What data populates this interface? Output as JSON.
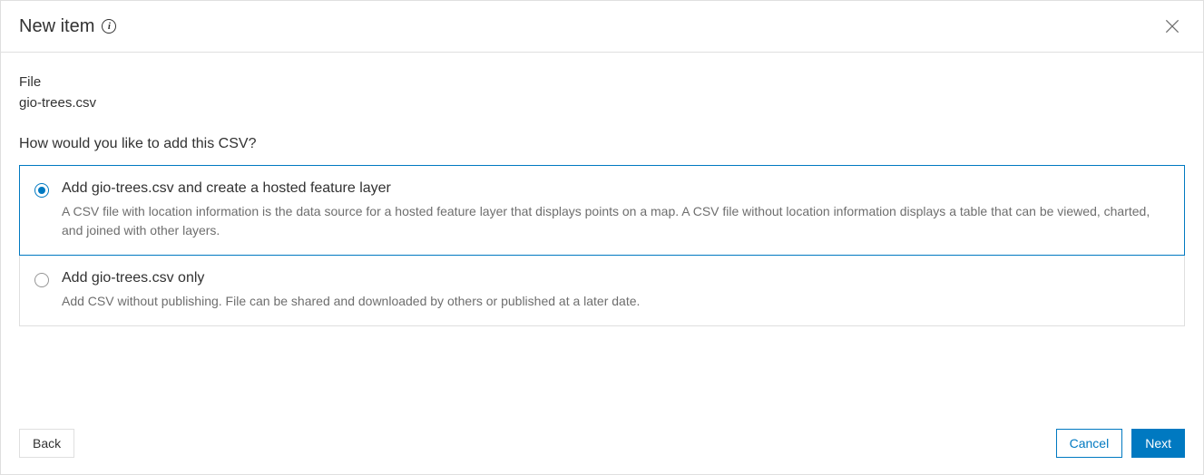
{
  "header": {
    "title": "New item"
  },
  "body": {
    "file_label": "File",
    "file_name": "gio-trees.csv",
    "question": "How would you like to add this CSV?",
    "options": [
      {
        "title": "Add gio-trees.csv and create a hosted feature layer",
        "desc": "A CSV file with location information is the data source for a hosted feature layer that displays points on a map. A CSV file without location information displays a table that can be viewed, charted, and joined with other layers.",
        "selected": true
      },
      {
        "title": "Add gio-trees.csv only",
        "desc": "Add CSV without publishing. File can be shared and downloaded by others or published at a later date.",
        "selected": false
      }
    ]
  },
  "footer": {
    "back": "Back",
    "cancel": "Cancel",
    "next": "Next"
  }
}
